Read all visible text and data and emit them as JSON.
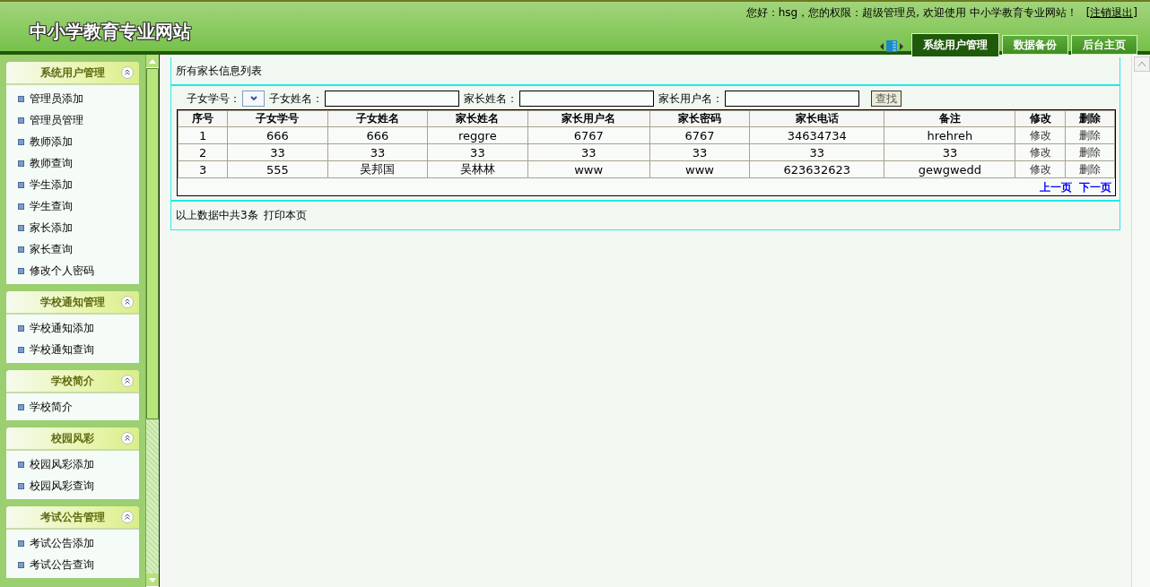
{
  "header": {
    "title": "中小学教育专业网站",
    "greeting": "您好：hsg，您的权限：超级管理员, 欢迎使用  中小学教育专业网站！",
    "logout": "[注销退出]",
    "tabs": [
      {
        "label": "系统用户管理",
        "selected": true
      },
      {
        "label": "数据备份",
        "selected": false
      },
      {
        "label": "后台主页",
        "selected": false
      }
    ]
  },
  "sidebar": {
    "sections": [
      {
        "title": "系统用户管理",
        "items": [
          "管理员添加",
          "管理员管理",
          "教师添加",
          "教师查询",
          "学生添加",
          "学生查询",
          "家长添加",
          "家长查询",
          "修改个人密码"
        ]
      },
      {
        "title": "学校通知管理",
        "items": [
          "学校通知添加",
          "学校通知查询"
        ]
      },
      {
        "title": "学校简介",
        "items": [
          "学校简介"
        ]
      },
      {
        "title": "校园风彩",
        "items": [
          "校园风彩添加",
          "校园风彩查询"
        ]
      },
      {
        "title": "考试公告管理",
        "items": [
          "考试公告添加",
          "考试公告查询"
        ]
      }
    ]
  },
  "content": {
    "title": "所有家长信息列表",
    "filters": [
      {
        "label": "子女学号：",
        "kind": "select"
      },
      {
        "label": "子女姓名：",
        "kind": "text"
      },
      {
        "label": "家长姓名：",
        "kind": "text"
      },
      {
        "label": "家长用户名：",
        "kind": "text"
      }
    ],
    "search_button": "查找",
    "table": {
      "columns": [
        {
          "label": "序号",
          "kind": "text"
        },
        {
          "label": "子女学号",
          "kind": "text"
        },
        {
          "label": "子女姓名",
          "kind": "text"
        },
        {
          "label": "家长姓名",
          "kind": "text"
        },
        {
          "label": "家长用户名",
          "kind": "text"
        },
        {
          "label": "家长密码",
          "kind": "text"
        },
        {
          "label": "家长电话",
          "kind": "text"
        },
        {
          "label": "备注",
          "kind": "text"
        },
        {
          "label": "修改",
          "kind": "action"
        },
        {
          "label": "删除",
          "kind": "action"
        }
      ],
      "rows": [
        [
          "1",
          "666",
          "666",
          "reggre",
          "6767",
          "6767",
          "34634734",
          "hrehreh",
          "修改",
          "删除"
        ],
        [
          "2",
          "33",
          "33",
          "33",
          "33",
          "33",
          "33",
          "33",
          "修改",
          "删除"
        ],
        [
          "3",
          "555",
          "吴邦国",
          "吴林林",
          "www",
          "www",
          "623632623",
          "gewgwedd",
          "修改",
          "删除"
        ]
      ]
    },
    "pager": [
      "上一页",
      "下一页"
    ],
    "summary": "以上数据中共3条",
    "print_link": "打印本页"
  }
}
